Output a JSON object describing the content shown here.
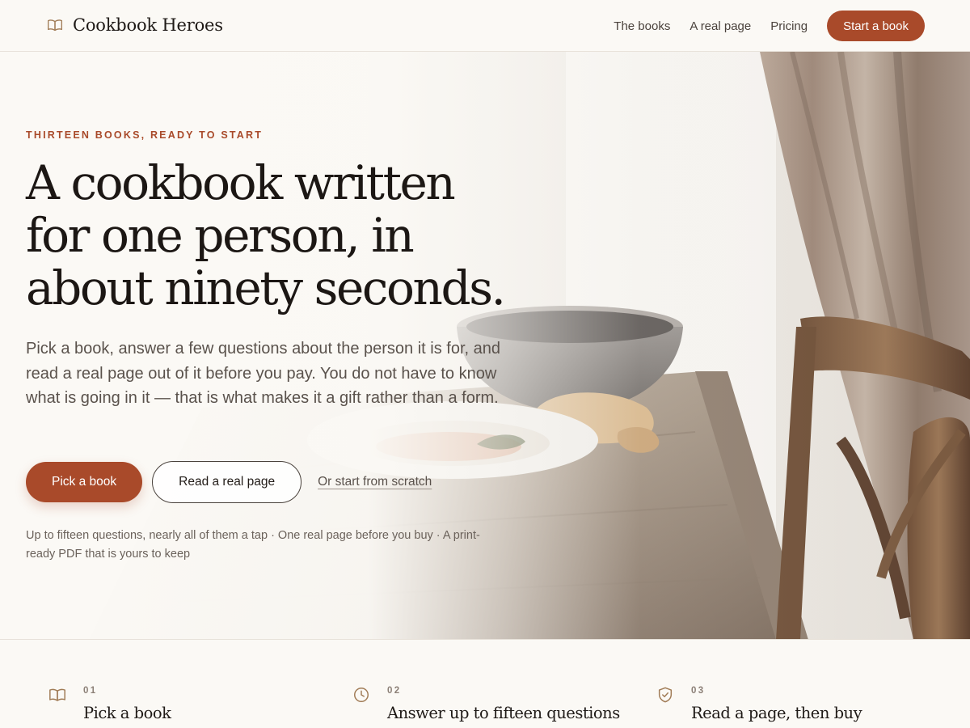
{
  "header": {
    "brand_name": "Cookbook Heroes",
    "brand_icon": "open-book-icon",
    "nav": [
      {
        "label": "The books"
      },
      {
        "label": "A real page"
      },
      {
        "label": "Pricing"
      }
    ],
    "cta_label": "Start a book"
  },
  "hero": {
    "eyebrow": "THIRTEEN BOOKS, READY TO START",
    "headline": "A cookbook written for one person, in about ninety seconds.",
    "lede": "Pick a book, answer a few questions about the person it is for, and read a real page out of it before you pay. You do not have to know what is going in it — that is what makes it a gift rather than a form.",
    "primary_cta": "Pick a book",
    "secondary_cta": "Read a real page",
    "text_link": "Or start from scratch",
    "fine_print": "Up to fifteen questions, nearly all of them a tap · One real page before you buy · A print-ready PDF that is yours to keep"
  },
  "steps": [
    {
      "number": "01",
      "title": "Pick a book",
      "icon": "open-book-icon"
    },
    {
      "number": "02",
      "title": "Answer up to fifteen questions",
      "icon": "clock-icon"
    },
    {
      "number": "03",
      "title": "Read a page, then buy",
      "icon": "shield-check-icon"
    }
  ],
  "colors": {
    "accent": "#a94a2a",
    "background": "#fbf9f5",
    "text": "#1c1714",
    "muted": "#5a524c"
  }
}
